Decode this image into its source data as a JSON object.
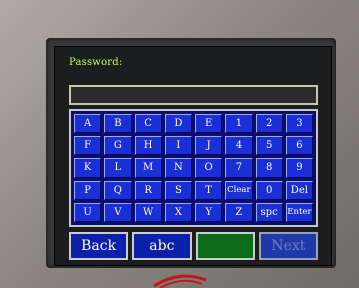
{
  "screen": {
    "prompt": "Password:",
    "password_value": ""
  },
  "keyboard": {
    "rows": [
      [
        "A",
        "B",
        "C",
        "D",
        "E",
        "1",
        "2",
        "3"
      ],
      [
        "F",
        "G",
        "H",
        "I",
        "J",
        "4",
        "5",
        "6"
      ],
      [
        "K",
        "L",
        "M",
        "N",
        "O",
        "7",
        "8",
        "9"
      ],
      [
        "P",
        "Q",
        "R",
        "S",
        "T",
        "Clear",
        "0",
        "Del"
      ],
      [
        "U",
        "V",
        "W",
        "X",
        "Y",
        "Z",
        "spc",
        "Enter"
      ]
    ]
  },
  "bottom_bar": {
    "back_label": "Back",
    "mode_label": "abc",
    "blank_label": "",
    "next_label": "Next"
  },
  "colors": {
    "key_blue": "#1a2fd6",
    "keyboard_bg": "#0b0f6a",
    "prompt_green": "#c9ff5a",
    "button_green": "#0c6b1a"
  },
  "icons": {
    "brand_logo": "red-swoosh-logo"
  }
}
